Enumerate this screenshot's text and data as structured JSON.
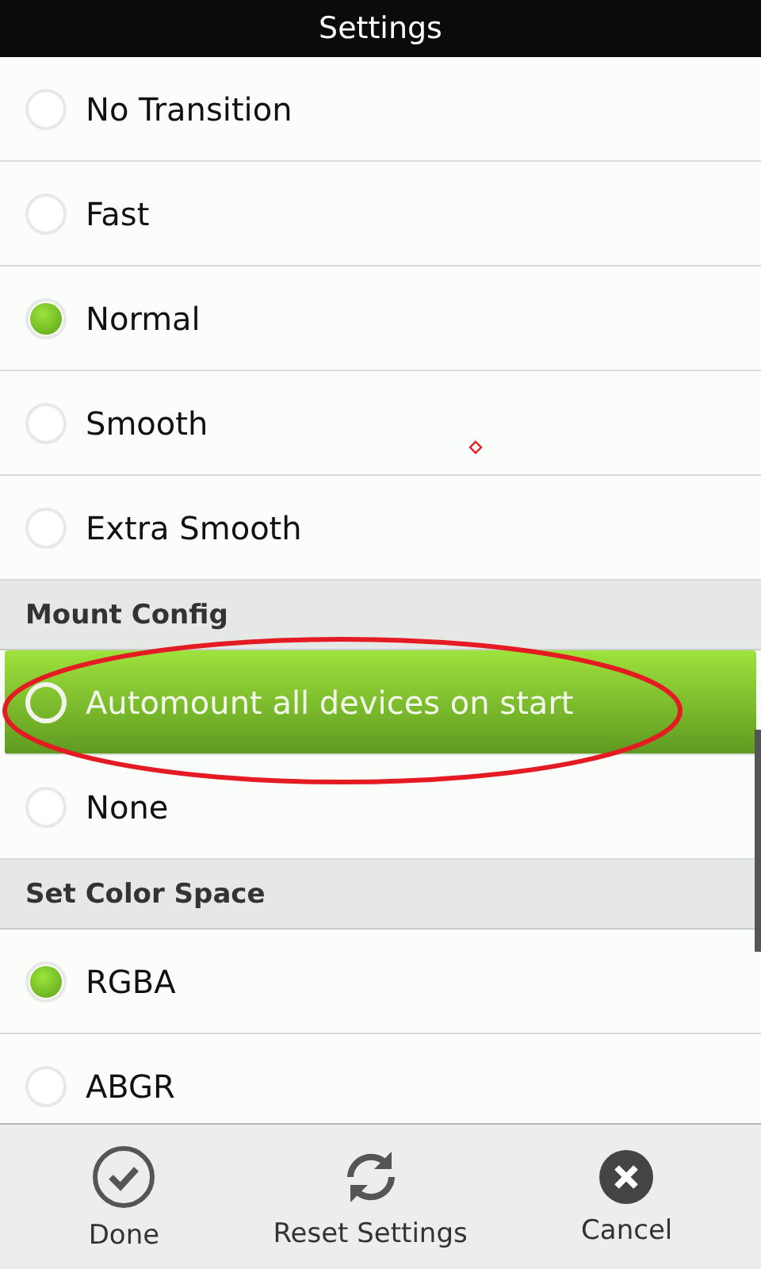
{
  "window": {
    "title": "Settings"
  },
  "items": [
    {
      "kind": "option",
      "label": "No Transition",
      "selected": false,
      "pressed": false,
      "circled": false
    },
    {
      "kind": "option",
      "label": "Fast",
      "selected": false,
      "pressed": false,
      "circled": false
    },
    {
      "kind": "option",
      "label": "Normal",
      "selected": true,
      "pressed": false,
      "circled": false
    },
    {
      "kind": "option",
      "label": "Smooth",
      "selected": false,
      "pressed": false,
      "circled": false
    },
    {
      "kind": "option",
      "label": "Extra Smooth",
      "selected": false,
      "pressed": false,
      "circled": false
    },
    {
      "kind": "header",
      "label": "Mount Config"
    },
    {
      "kind": "option",
      "label": "Automount all devices on start",
      "selected": false,
      "pressed": true,
      "circled": true
    },
    {
      "kind": "option",
      "label": "None",
      "selected": false,
      "pressed": false,
      "circled": false
    },
    {
      "kind": "header",
      "label": "Set Color Space"
    },
    {
      "kind": "option",
      "label": "RGBA",
      "selected": true,
      "pressed": false,
      "circled": false
    },
    {
      "kind": "option",
      "label": "ABGR",
      "selected": false,
      "pressed": false,
      "circled": false
    }
  ],
  "stray_mark": true,
  "buttons": [
    {
      "kind": "done",
      "label": "Done"
    },
    {
      "kind": "reset",
      "label": "Reset Settings"
    },
    {
      "kind": "cancel",
      "label": "Cancel"
    }
  ]
}
